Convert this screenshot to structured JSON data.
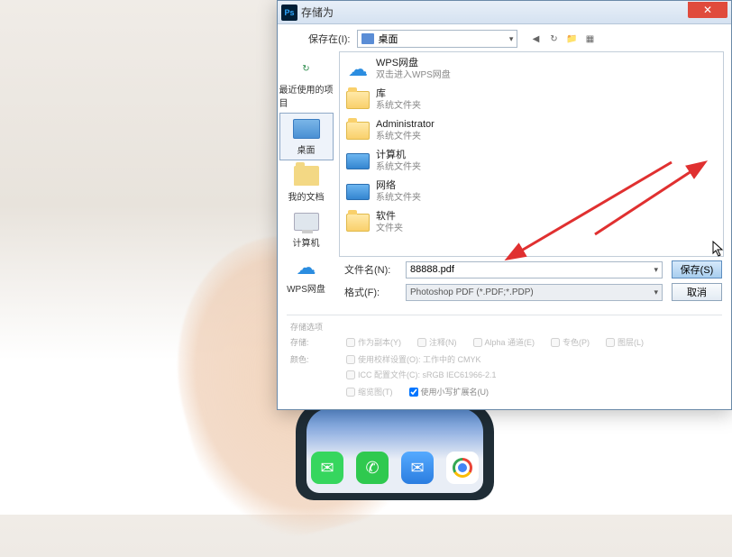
{
  "dialog": {
    "title": "存储为",
    "look_in_label": "保存在(I):",
    "look_in_value": "桌面"
  },
  "sidebar": {
    "items": [
      {
        "label": "最近使用的项目"
      },
      {
        "label": "桌面"
      },
      {
        "label": "我的文档"
      },
      {
        "label": "计算机"
      },
      {
        "label": "WPS网盘"
      }
    ]
  },
  "filelist": {
    "items": [
      {
        "name": "WPS网盘",
        "sub": "双击进入WPS网盘",
        "icon": "cloud"
      },
      {
        "name": "库",
        "sub": "系统文件夹",
        "icon": "folder"
      },
      {
        "name": "Administrator",
        "sub": "系统文件夹",
        "icon": "folder"
      },
      {
        "name": "计算机",
        "sub": "系统文件夹",
        "icon": "monitor"
      },
      {
        "name": "网络",
        "sub": "系统文件夹",
        "icon": "monitor"
      },
      {
        "name": "软件",
        "sub": "文件夹",
        "icon": "folder"
      }
    ]
  },
  "fields": {
    "filename_label": "文件名(N):",
    "filename_value": "88888.pdf",
    "format_label": "格式(F):",
    "format_value": "Photoshop PDF (*.PDF;*.PDP)",
    "save_btn": "保存(S)",
    "cancel_btn": "取消"
  },
  "options": {
    "section_title": "存储选项",
    "save_label": "存储:",
    "chk_copy": "作为副本(Y)",
    "chk_notes": "注释(N)",
    "chk_alpha": "Alpha 通道(E)",
    "chk_spot": "专色(P)",
    "chk_layers": "图层(L)",
    "color_label": "颜色:",
    "chk_proof": "使用校样设置(O): 工作中的 CMYK",
    "chk_icc": "ICC 配置文件(C): sRGB IEC61966-2.1",
    "chk_thumb": "缩览图(T)",
    "chk_lowercase": "使用小写扩展名(U)"
  }
}
